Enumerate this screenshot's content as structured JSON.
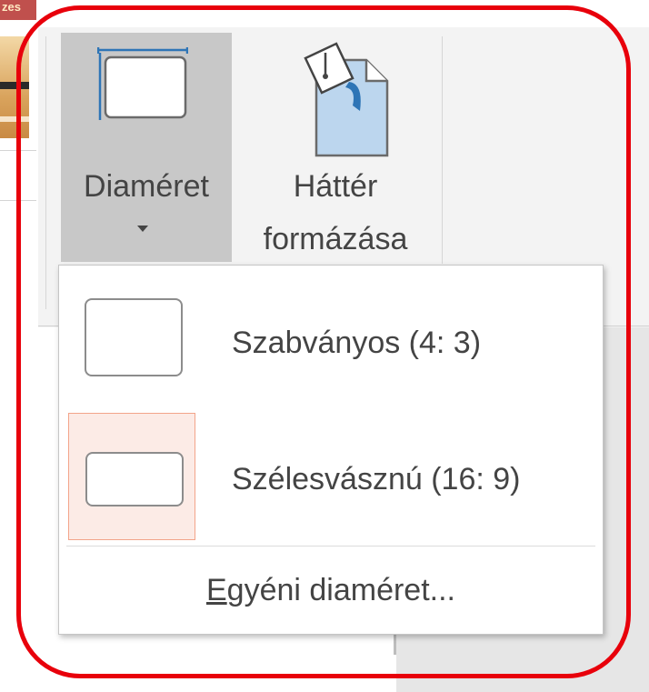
{
  "left_strip": {
    "theme_tab_text": "zes"
  },
  "ribbon": {
    "diameret_button": {
      "label": "Diaméret",
      "icon": "slide-size-icon"
    },
    "hatter_button": {
      "label_line1": "Háttér",
      "label_line2": "formázása",
      "icon": "format-background-icon"
    }
  },
  "dropdown": {
    "items": [
      {
        "label": "Szabványos (4: 3)",
        "icon": "standard-4-3-icon",
        "highlighted": false
      },
      {
        "label": "Szélesvásznú (16: 9)",
        "icon": "widescreen-16-9-icon",
        "highlighted": true
      }
    ],
    "custom": {
      "accel": "E",
      "rest": "gyéni diaméret..."
    }
  },
  "colors": {
    "highlight_frame": "#e8000b",
    "pressed_button": "#c8c8c8",
    "hover_item_bg": "#fcebe6",
    "hover_item_border": "#f3a48a",
    "icon_blue": "#2e75b6"
  }
}
